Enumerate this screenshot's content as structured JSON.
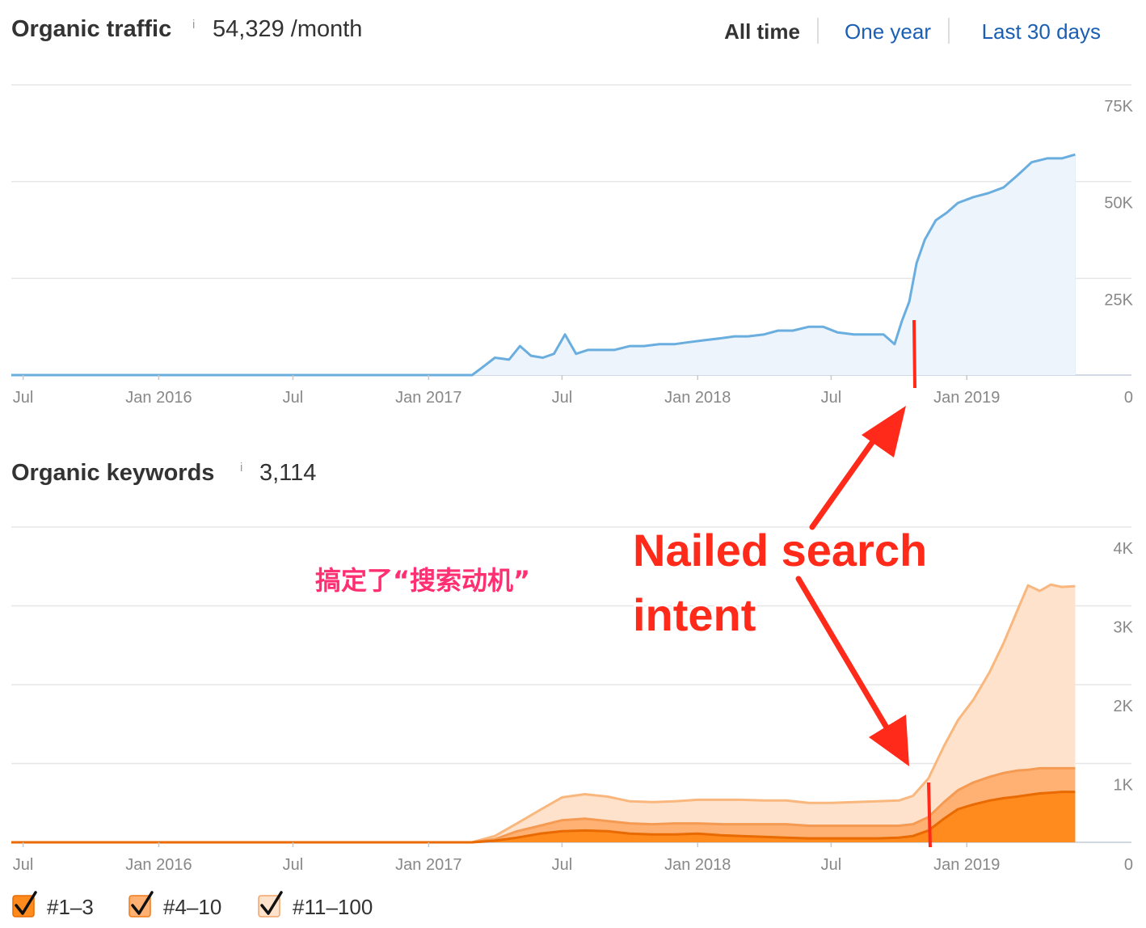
{
  "traffic_panel": {
    "title": "Organic traffic",
    "info": "i",
    "value": "54,329 /month",
    "ranges": [
      {
        "label": "All time",
        "active": true
      },
      {
        "label": "One year",
        "active": false
      },
      {
        "label": "Last 30 days",
        "active": false
      }
    ]
  },
  "keywords_panel": {
    "title": "Organic keywords",
    "info": "i",
    "value": "3,114"
  },
  "annotations": {
    "callout_line1": "Nailed search",
    "callout_line2": "intent",
    "callout_cn": "搞定了“搜索动机”"
  },
  "colors": {
    "traffic_line": "#6aaee0",
    "traffic_fill": "#eef4fc",
    "top3": "#ff8a1e",
    "top10": "#ffb173",
    "top100": "#ffe2cb",
    "annotation_red": "#ff2a1a",
    "active_range": "#333333",
    "link_range": "#1a5fb4"
  },
  "chart_data": [
    {
      "type": "area",
      "title": "Organic traffic",
      "x_tick_labels": [
        "Jul",
        "Jan 2016",
        "Jul",
        "Jan 2017",
        "Jul",
        "Jan 2018",
        "Jul",
        "Jan 2019"
      ],
      "x_tick_dates": [
        "2015-07-01",
        "2016-01-01",
        "2016-07-01",
        "2017-01-01",
        "2017-07-01",
        "2018-01-01",
        "2018-07-01",
        "2019-01-01"
      ],
      "y_tick_labels": [
        "75K",
        "50K",
        "25K",
        "0"
      ],
      "y_tick_values": [
        75000,
        50000,
        25000,
        0
      ],
      "xlim": [
        "2015-06-15",
        "2019-06-01"
      ],
      "ylim": [
        0,
        75000
      ],
      "grid": true,
      "series": [
        {
          "x": [
            "2015-06-15",
            "2017-03-01",
            "2017-03-15",
            "2017-04-01",
            "2017-04-20",
            "2017-05-05",
            "2017-05-20",
            "2017-06-05",
            "2017-06-20",
            "2017-07-05",
            "2017-07-20",
            "2017-08-05",
            "2017-08-20",
            "2017-09-10",
            "2017-10-01",
            "2017-10-20",
            "2017-11-10",
            "2017-12-01",
            "2017-12-20",
            "2018-01-10",
            "2018-02-01",
            "2018-02-20",
            "2018-03-10",
            "2018-04-01",
            "2018-04-20",
            "2018-05-10",
            "2018-06-01",
            "2018-06-20",
            "2018-07-10",
            "2018-08-01",
            "2018-08-20",
            "2018-09-10",
            "2018-09-25",
            "2018-10-05",
            "2018-10-15",
            "2018-10-25",
            "2018-11-05",
            "2018-11-20",
            "2018-12-05",
            "2018-12-20",
            "2019-01-10",
            "2019-01-30",
            "2019-02-20",
            "2019-03-10",
            "2019-03-30",
            "2019-04-20",
            "2019-05-10",
            "2019-05-28"
          ],
          "values": [
            0,
            0,
            2000,
            4500,
            4000,
            7500,
            5000,
            4500,
            5500,
            10500,
            5500,
            6500,
            6500,
            6500,
            7500,
            7500,
            8000,
            8000,
            8500,
            9000,
            9500,
            10000,
            10000,
            10500,
            11500,
            11500,
            12500,
            12500,
            11000,
            10500,
            10500,
            10500,
            8000,
            14000,
            19000,
            29000,
            35000,
            40000,
            42000,
            44500,
            46000,
            47000,
            48500,
            51500,
            55000,
            56000,
            56000,
            57000
          ]
        }
      ]
    },
    {
      "type": "area",
      "title": "Organic keywords",
      "x_tick_labels": [
        "Jul",
        "Jan 2016",
        "Jul",
        "Jan 2017",
        "Jul",
        "Jan 2018",
        "Jul",
        "Jan 2019"
      ],
      "x_tick_dates": [
        "2015-07-01",
        "2016-01-01",
        "2016-07-01",
        "2017-01-01",
        "2017-07-01",
        "2018-01-01",
        "2018-07-01",
        "2019-01-01"
      ],
      "y_tick_labels": [
        "4K",
        "3K",
        "2K",
        "1K",
        "0"
      ],
      "y_tick_values": [
        4000,
        3000,
        2000,
        1000,
        0
      ],
      "xlim": [
        "2015-06-15",
        "2019-06-01"
      ],
      "ylim": [
        0,
        4000
      ],
      "stacked": true,
      "grid": true,
      "legend": "bottom-left",
      "categories_x": [
        "2015-06-15",
        "2017-03-01",
        "2017-04-01",
        "2017-05-01",
        "2017-06-01",
        "2017-07-01",
        "2017-08-01",
        "2017-09-01",
        "2017-10-01",
        "2017-11-01",
        "2017-12-01",
        "2018-01-01",
        "2018-02-01",
        "2018-03-01",
        "2018-04-01",
        "2018-05-01",
        "2018-06-01",
        "2018-07-01",
        "2018-08-01",
        "2018-09-01",
        "2018-10-01",
        "2018-10-20",
        "2018-11-10",
        "2018-12-01",
        "2018-12-20",
        "2019-01-10",
        "2019-02-01",
        "2019-02-20",
        "2019-03-10",
        "2019-03-25",
        "2019-04-10",
        "2019-04-25",
        "2019-05-10",
        "2019-05-28"
      ],
      "series": [
        {
          "name": "#1–3",
          "values": [
            0,
            0,
            20,
            60,
            110,
            140,
            150,
            140,
            110,
            100,
            100,
            110,
            90,
            80,
            70,
            60,
            50,
            50,
            50,
            50,
            60,
            80,
            150,
            300,
            420,
            480,
            530,
            560,
            580,
            600,
            620,
            630,
            640,
            640
          ]
        },
        {
          "name": "#4–10",
          "values": [
            0,
            0,
            20,
            80,
            100,
            140,
            150,
            130,
            130,
            130,
            140,
            130,
            140,
            150,
            160,
            170,
            160,
            160,
            160,
            160,
            150,
            150,
            170,
            210,
            240,
            280,
            300,
            320,
            330,
            320,
            320,
            310,
            300,
            300
          ]
        },
        {
          "name": "#11–100",
          "values": [
            0,
            0,
            40,
            100,
            200,
            290,
            310,
            310,
            280,
            280,
            280,
            300,
            310,
            310,
            300,
            300,
            290,
            290,
            300,
            310,
            320,
            360,
            490,
            710,
            890,
            1050,
            1330,
            1650,
            2020,
            2340,
            2250,
            2330,
            2300,
            2310
          ]
        }
      ]
    }
  ]
}
